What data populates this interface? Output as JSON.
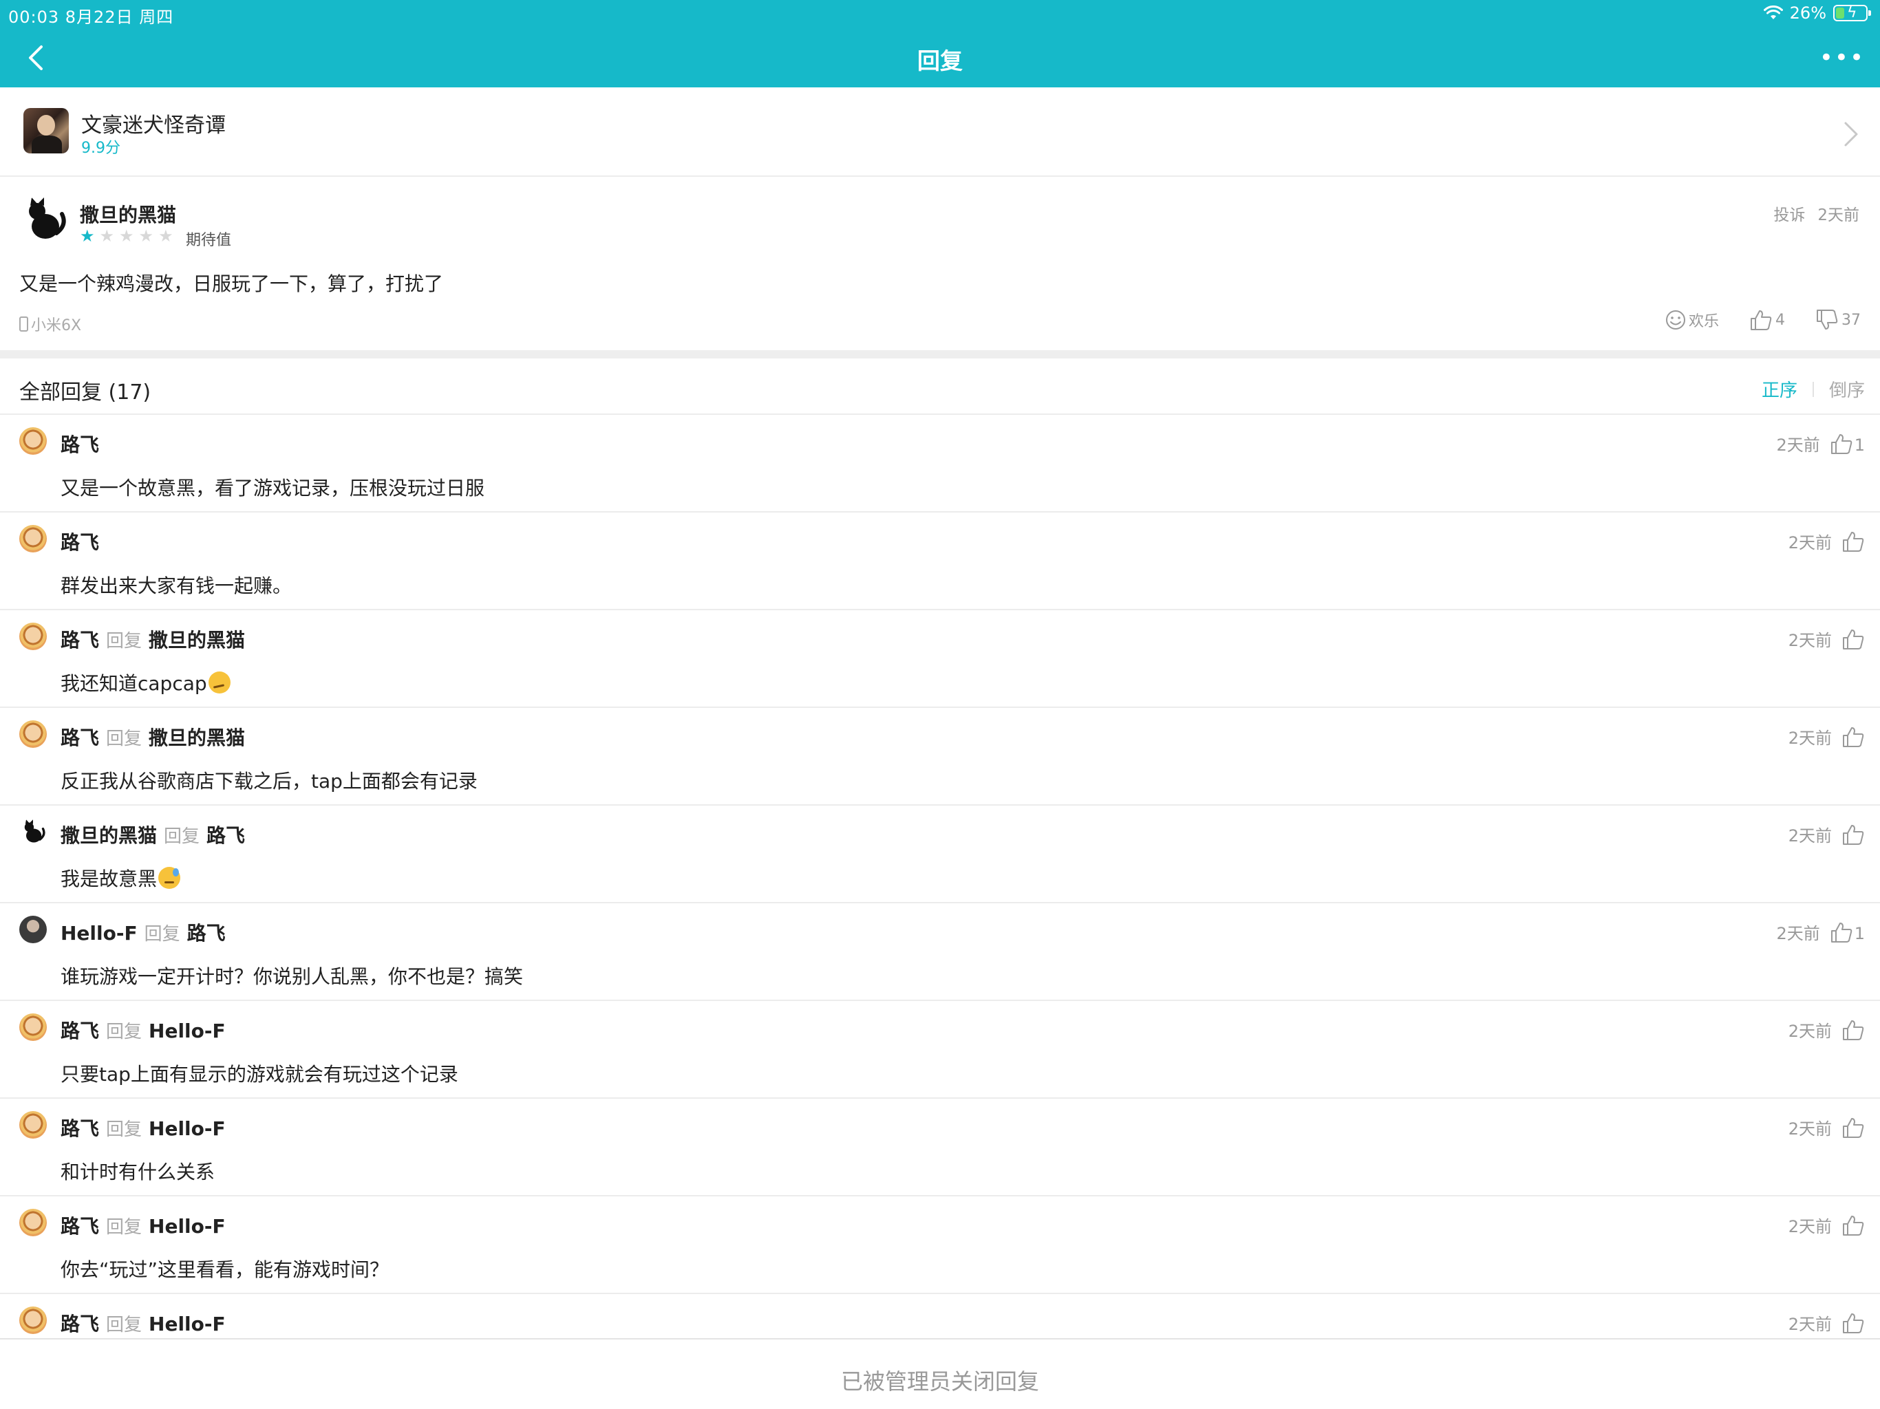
{
  "status": {
    "time_date": "00:03   8月22日 周四",
    "battery_percent": "26%",
    "battery_level": 0.26
  },
  "nav": {
    "title": "回复",
    "more": "•••"
  },
  "game": {
    "title": "文豪迷犬怪奇谭",
    "score": "9.9分"
  },
  "review": {
    "author": "撒旦的黑猫",
    "stars_filled": 1,
    "stars_total": 5,
    "expectation_label": "期待值",
    "report_label": "投诉",
    "time": "2天前",
    "body": "又是一个辣鸡漫改，日服玩了一下，算了，打扰了",
    "device": "小米6X",
    "fun_label": "欢乐",
    "likes": "4",
    "dislikes": "37"
  },
  "replies_header": {
    "title": "全部回复 (17)",
    "sort_asc": "正序",
    "sort_desc": "倒序"
  },
  "reply_word": "回复",
  "replies": [
    {
      "author": "路飞",
      "target": "",
      "text": "又是一个故意黑，看了游戏记录，压根没玩过日服",
      "emoji": "",
      "time": "2天前",
      "likes": "1",
      "avatar": "luffy"
    },
    {
      "author": "路飞",
      "target": "",
      "text": "群发出来大家有钱一起赚。",
      "emoji": "",
      "time": "2天前",
      "likes": "",
      "avatar": "luffy"
    },
    {
      "author": "路飞",
      "target": "撒旦的黑猫",
      "text": "我还知道capcap",
      "emoji": "smirk",
      "time": "2天前",
      "likes": "",
      "avatar": "luffy"
    },
    {
      "author": "路飞",
      "target": "撒旦的黑猫",
      "text": "反正我从谷歌商店下载之后，tap上面都会有记录",
      "emoji": "",
      "time": "2天前",
      "likes": "",
      "avatar": "luffy"
    },
    {
      "author": "撒旦的黑猫",
      "target": "路飞",
      "text": "我是故意黑",
      "emoji": "sweat",
      "time": "2天前",
      "likes": "",
      "avatar": "cat"
    },
    {
      "author": "Hello-F",
      "target": "路飞",
      "text": "谁玩游戏一定开计时？你说别人乱黑，你不也是？搞笑",
      "emoji": "",
      "time": "2天前",
      "likes": "1",
      "avatar": "hello"
    },
    {
      "author": "路飞",
      "target": "Hello-F",
      "text": "只要tap上面有显示的游戏就会有玩过这个记录",
      "emoji": "",
      "time": "2天前",
      "likes": "",
      "avatar": "luffy"
    },
    {
      "author": "路飞",
      "target": "Hello-F",
      "text": "和计时有什么关系",
      "emoji": "",
      "time": "2天前",
      "likes": "",
      "avatar": "luffy"
    },
    {
      "author": "路飞",
      "target": "Hello-F",
      "text": "你去“玩过”这里看看，能有游戏时间？",
      "emoji": "",
      "time": "2天前",
      "likes": "",
      "avatar": "luffy"
    },
    {
      "author": "路飞",
      "target": "Hello-F",
      "text": "",
      "emoji": "",
      "time": "2天前",
      "likes": "",
      "avatar": "luffy"
    }
  ],
  "footer": {
    "text": "已被管理员关闭回复"
  },
  "colors": {
    "accent": "#16b9c9",
    "muted": "#999999",
    "divider": "#ececec"
  }
}
